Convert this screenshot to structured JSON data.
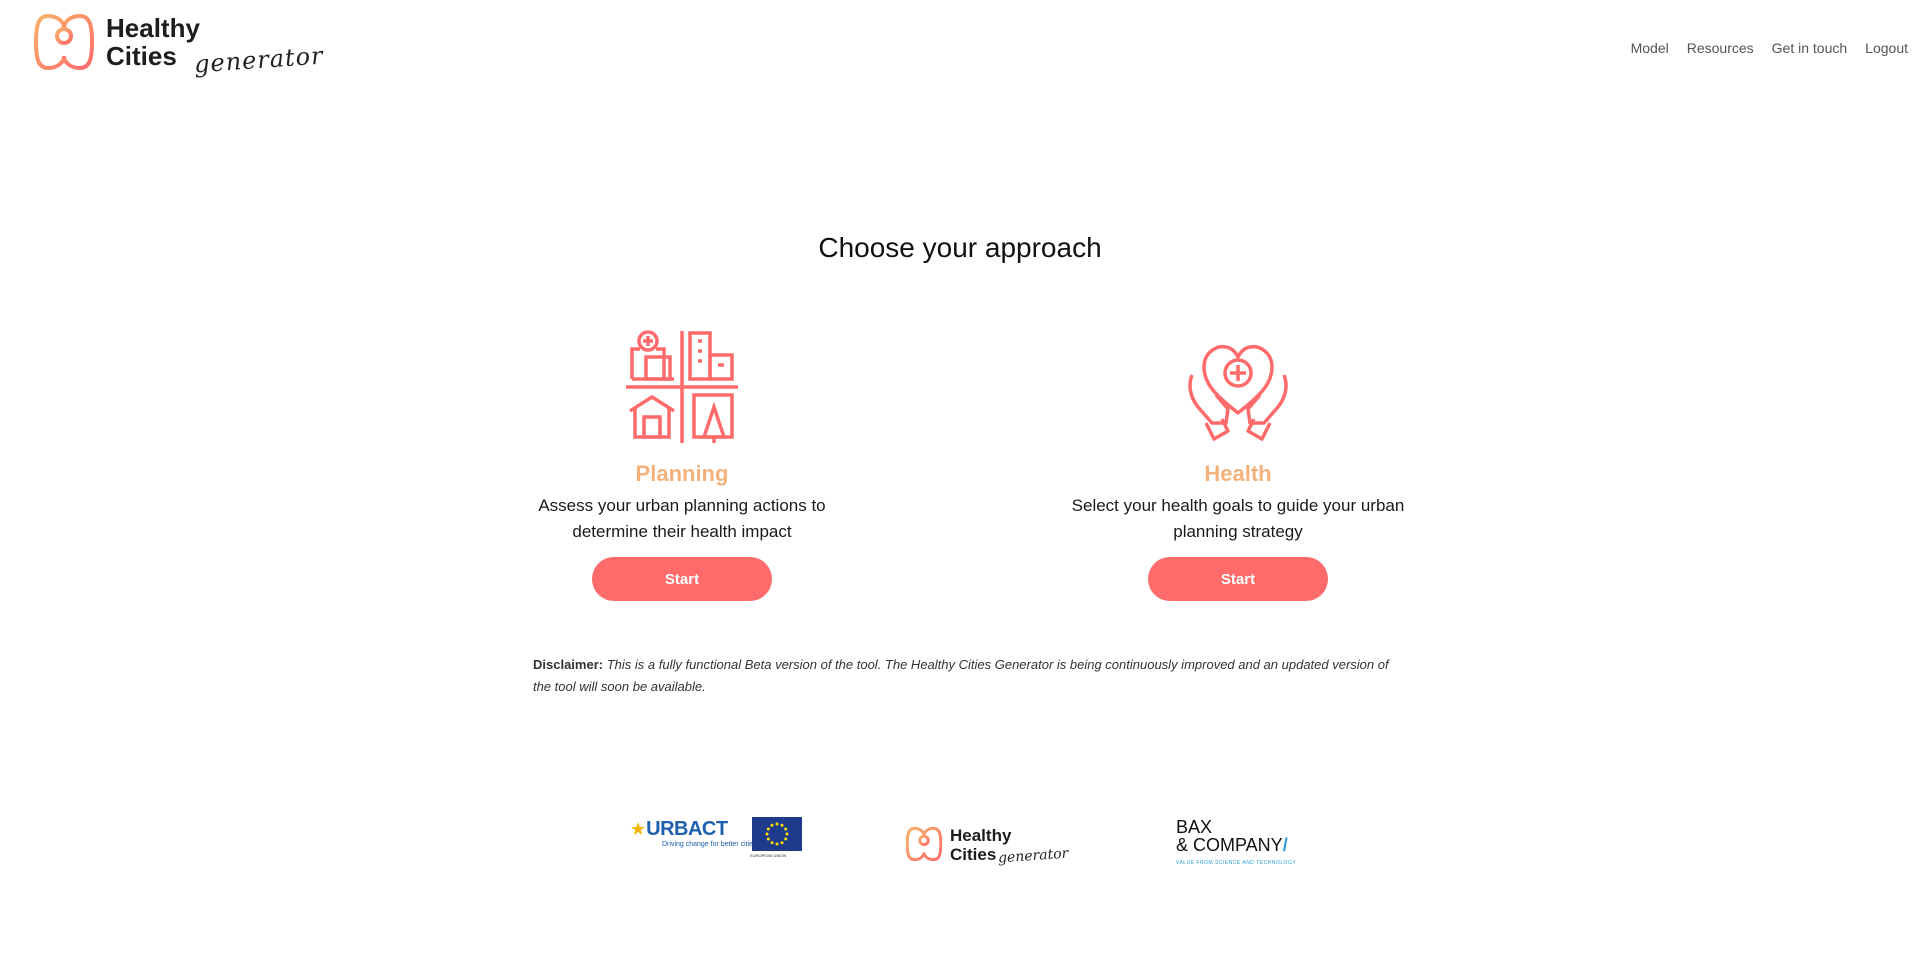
{
  "header": {
    "logo_line1": "Healthy",
    "logo_line2": "Cities",
    "logo_script": "generator",
    "nav": [
      "Model",
      "Resources",
      "Get in touch",
      "Logout"
    ]
  },
  "main": {
    "title": "Choose your approach",
    "cards": [
      {
        "title": "Planning",
        "description": "Assess your urban planning actions to determine their health impact",
        "button": "Start",
        "icon": "city-buildings-icon"
      },
      {
        "title": "Health",
        "description": "Select your health goals to guide your urban planning strategy",
        "button": "Start",
        "icon": "heart-hands-icon"
      }
    ],
    "disclaimer_label": "Disclaimer:",
    "disclaimer_text": "This is a fully functional Beta version of the tool. The Healthy Cities Generator is being continuously improved and an updated version of the tool will soon be available."
  },
  "footer": {
    "urbact_name": "URBACT",
    "urbact_tagline": "Driving change for better cities",
    "eu_caption": "EUROPEAN UNION",
    "hcg_line1": "Healthy",
    "hcg_line2": "Cities",
    "hcg_script": "generator",
    "bax_line1": "BAX",
    "bax_line2": "& COMPANY",
    "bax_tagline": "VALUE FROM SCIENCE AND TECHNOLOGY"
  },
  "colors": {
    "accent": "#ff6b6b",
    "card_title": "#f4b27a",
    "logo_gradient_start": "#f8b26a",
    "logo_gradient_end": "#ff6b6b"
  }
}
